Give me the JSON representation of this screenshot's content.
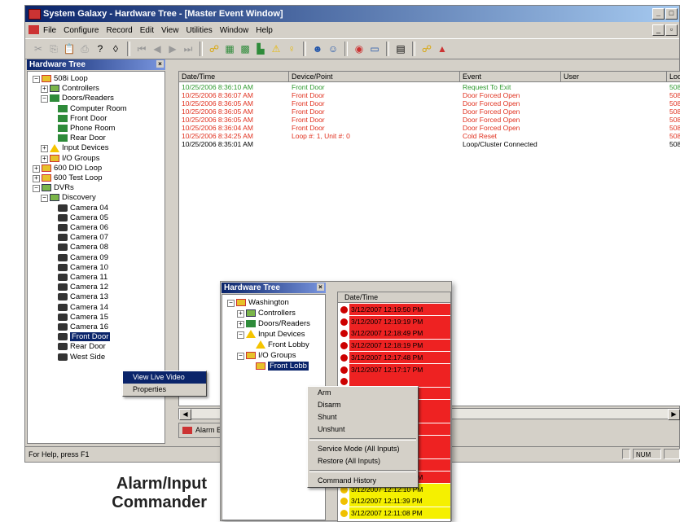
{
  "window": {
    "title": "System Galaxy - Hardware Tree - [Master Event Window]",
    "controls": [
      "_",
      "□",
      "×"
    ],
    "mdi_controls": [
      "_",
      "▫",
      "×"
    ]
  },
  "menu": [
    "File",
    "Configure",
    "Record",
    "Edit",
    "View",
    "Utilities",
    "Window",
    "Help"
  ],
  "hardware_tree": {
    "title": "Hardware Tree",
    "close": "×",
    "items": [
      {
        "label": "508i Loop",
        "icon": "loop-icon",
        "exp": "−",
        "depth": 0
      },
      {
        "label": "Controllers",
        "icon": "controller-icon",
        "exp": "+",
        "depth": 1
      },
      {
        "label": "Doors/Readers",
        "icon": "door-icon",
        "exp": "−",
        "depth": 1
      },
      {
        "label": "Computer Room",
        "icon": "door-icon",
        "exp": "",
        "depth": 2
      },
      {
        "label": "Front Door",
        "icon": "door-icon",
        "exp": "",
        "depth": 2
      },
      {
        "label": "Phone Room",
        "icon": "door-icon",
        "exp": "",
        "depth": 2
      },
      {
        "label": "Rear Door",
        "icon": "door-icon",
        "exp": "",
        "depth": 2
      },
      {
        "label": "Input Devices",
        "icon": "warning-icon",
        "exp": "+",
        "depth": 1
      },
      {
        "label": "I/O Groups",
        "icon": "io-group-icon",
        "exp": "+",
        "depth": 1
      },
      {
        "label": "600 DIO Loop",
        "icon": "loop-icon",
        "exp": "+",
        "depth": 0
      },
      {
        "label": "600 Test Loop",
        "icon": "loop-icon",
        "exp": "+",
        "depth": 0
      },
      {
        "label": "DVRs",
        "icon": "dvr-icon",
        "exp": "−",
        "depth": 0
      },
      {
        "label": "Discovery",
        "icon": "dvr-icon",
        "exp": "−",
        "depth": 1
      },
      {
        "label": "Camera 04",
        "icon": "camera-icon",
        "exp": "",
        "depth": 2
      },
      {
        "label": "Camera 05",
        "icon": "camera-icon",
        "exp": "",
        "depth": 2
      },
      {
        "label": "Camera 06",
        "icon": "camera-icon",
        "exp": "",
        "depth": 2
      },
      {
        "label": "Camera 07",
        "icon": "camera-icon",
        "exp": "",
        "depth": 2
      },
      {
        "label": "Camera 08",
        "icon": "camera-icon",
        "exp": "",
        "depth": 2
      },
      {
        "label": "Camera 09",
        "icon": "camera-icon",
        "exp": "",
        "depth": 2
      },
      {
        "label": "Camera 10",
        "icon": "camera-icon",
        "exp": "",
        "depth": 2
      },
      {
        "label": "Camera 11",
        "icon": "camera-icon",
        "exp": "",
        "depth": 2
      },
      {
        "label": "Camera 12",
        "icon": "camera-icon",
        "exp": "",
        "depth": 2
      },
      {
        "label": "Camera 13",
        "icon": "camera-icon",
        "exp": "",
        "depth": 2
      },
      {
        "label": "Camera 14",
        "icon": "camera-icon",
        "exp": "",
        "depth": 2
      },
      {
        "label": "Camera 15",
        "icon": "camera-icon",
        "exp": "",
        "depth": 2
      },
      {
        "label": "Camera 16",
        "icon": "camera-icon",
        "exp": "",
        "depth": 2
      },
      {
        "label": "Front Door",
        "icon": "camera-icon",
        "exp": "",
        "depth": 2,
        "selected": true
      },
      {
        "label": "Rear Door",
        "icon": "camera-icon",
        "exp": "",
        "depth": 2
      },
      {
        "label": "West Side",
        "icon": "camera-icon",
        "exp": "",
        "depth": 2
      }
    ]
  },
  "camera_menu": [
    "View Live Video",
    "Properties"
  ],
  "events": {
    "columns": [
      "Date/Time",
      "Device/Point",
      "Event",
      "User",
      "Loop"
    ],
    "rows": [
      {
        "date": "10/25/2006 8:36:10 AM",
        "device": "Front Door",
        "event": "Request To Exit",
        "user": "",
        "loop": "508i Lo",
        "color": "#2e9a2e"
      },
      {
        "date": "10/25/2006 8:36:07 AM",
        "device": "Front Door",
        "event": "Door Forced Open",
        "user": "",
        "loop": "508i Lo",
        "color": "#e0301e"
      },
      {
        "date": "10/25/2006 8:36:05 AM",
        "device": "Front Door",
        "event": "Door Forced Open",
        "user": "",
        "loop": "508i Lo",
        "color": "#e0301e"
      },
      {
        "date": "10/25/2006 8:36:05 AM",
        "device": "Front Door",
        "event": "Door Forced Open",
        "user": "",
        "loop": "508i Lo",
        "color": "#e0301e"
      },
      {
        "date": "10/25/2006 8:36:05 AM",
        "device": "Front Door",
        "event": "Door Forced Open",
        "user": "",
        "loop": "508i Lo",
        "color": "#e0301e"
      },
      {
        "date": "10/25/2006 8:36:04 AM",
        "device": "Front Door",
        "event": "Door Forced Open",
        "user": "",
        "loop": "508i Lo",
        "color": "#e0301e"
      },
      {
        "date": "10/25/2006 8:34:25 AM",
        "device": "Loop #: 1, Unit #: 0",
        "event": "Cold Reset",
        "user": "",
        "loop": "508i Lo",
        "color": "#e0301e"
      },
      {
        "date": "10/25/2006 8:35:01 AM",
        "device": "",
        "event": "Loop/Cluster Connected",
        "user": "",
        "loop": "508i Lo",
        "color": "#000000"
      }
    ]
  },
  "tab": {
    "label": "Alarm E"
  },
  "status": {
    "help": "For Help, press F1",
    "num": "NUM"
  },
  "inset": {
    "title": "Hardware Tree",
    "close": "×",
    "tree": [
      {
        "label": "Washington",
        "icon": "loop-icon",
        "exp": "−",
        "depth": 0
      },
      {
        "label": "Controllers",
        "icon": "controller-icon",
        "exp": "+",
        "depth": 1
      },
      {
        "label": "Doors/Readers",
        "icon": "door-icon",
        "exp": "+",
        "depth": 1
      },
      {
        "label": "Input Devices",
        "icon": "warning-icon",
        "exp": "−",
        "depth": 1
      },
      {
        "label": "Front Lobby",
        "icon": "warning-icon",
        "exp": "",
        "depth": 2
      },
      {
        "label": "I/O Groups",
        "icon": "io-group-icon",
        "exp": "−",
        "depth": 1
      },
      {
        "label": "Front Lobb",
        "icon": "io-group-icon",
        "exp": "",
        "depth": 2,
        "selected": true
      }
    ],
    "grid_header": "Date/Time",
    "alarms": [
      {
        "date": "3/12/2007 12:19:50 PM",
        "color": "#ee2222",
        "dot": "#cc0000"
      },
      {
        "date": "3/12/2007 12:19:19 PM",
        "color": "#ee2222",
        "dot": "#cc0000"
      },
      {
        "date": "3/12/2007 12:18:49 PM",
        "color": "#ee2222",
        "dot": "#cc0000"
      },
      {
        "date": "3/12/2007 12:18:19 PM",
        "color": "#ee2222",
        "dot": "#cc0000"
      },
      {
        "date": "3/12/2007 12:17:48 PM",
        "color": "#ee2222",
        "dot": "#cc0000"
      },
      {
        "date": "3/12/2007 12:17:17 PM",
        "color": "#ee2222",
        "dot": "#cc0000"
      },
      {
        "date": "",
        "color": "#ee2222",
        "dot": "#cc0000"
      },
      {
        "date": "",
        "color": "#ee2222",
        "dot": "#cc0000"
      },
      {
        "date": "",
        "color": "#ee2222",
        "dot": "#cc0000"
      },
      {
        "date": "",
        "color": "#ee2222",
        "dot": "#cc0000"
      },
      {
        "date": "",
        "color": "#ee2222",
        "dot": "#cc0000"
      },
      {
        "date": "",
        "color": "#ee2222",
        "dot": "#cc0000"
      },
      {
        "date": "",
        "color": "#ee2222",
        "dot": "#cc0000"
      },
      {
        "date": "",
        "color": "#ee2222",
        "dot": "#cc0000"
      },
      {
        "date": "3/12/2007 12:12:41 PM",
        "color": "#ee2222",
        "dot": "#cc0000"
      },
      {
        "date": "3/12/2007 12:12:10 PM",
        "color": "#f5f000",
        "dot": "#f0c000"
      },
      {
        "date": "3/12/2007 12:11:39 PM",
        "color": "#f5f000",
        "dot": "#f0c000"
      },
      {
        "date": "3/12/2007 12:11:08 PM",
        "color": "#f5f000",
        "dot": "#f0c000"
      }
    ],
    "context_menu": [
      "Arm",
      "Disarm",
      "Shunt",
      "Unshunt",
      "-",
      "Service Mode (All Inputs)",
      "Restore (All Inputs)",
      "-",
      "Command History"
    ]
  },
  "caption": {
    "line1": "Alarm/Input",
    "line2": "Commander"
  }
}
